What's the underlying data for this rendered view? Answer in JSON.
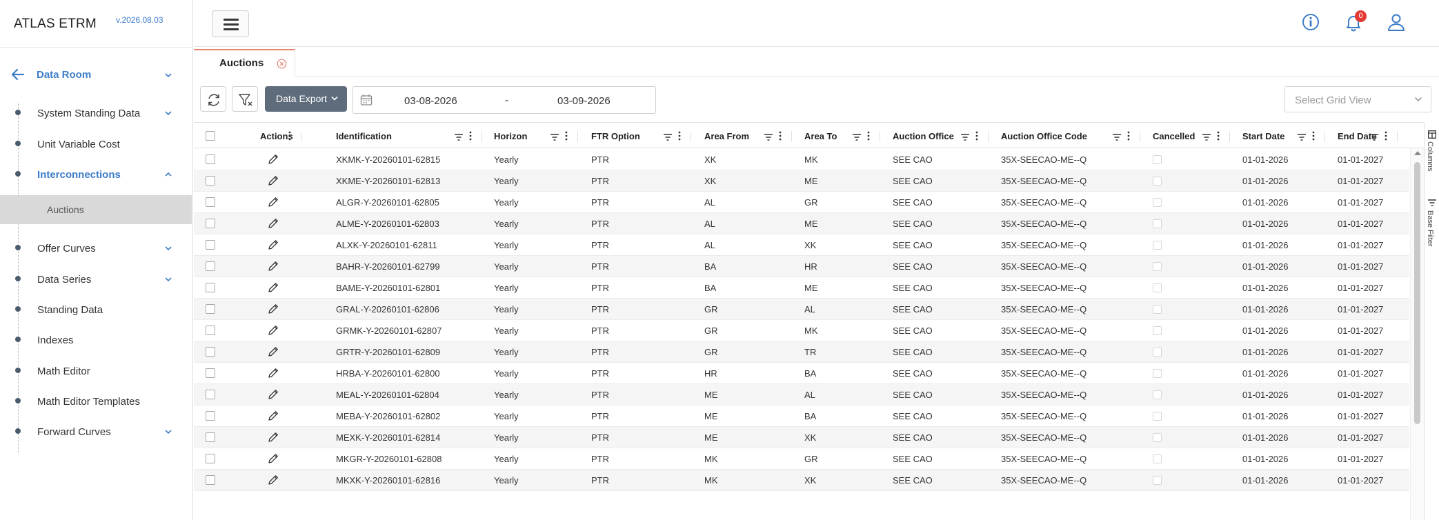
{
  "app": {
    "title": "ATLAS ETRM",
    "version": "v.2026.08.03"
  },
  "sidebar": {
    "top": {
      "label": "Data Room"
    },
    "items": [
      {
        "label": "System Standing Data",
        "expandable": true
      },
      {
        "label": "Unit Variable Cost",
        "expandable": false
      },
      {
        "label": "Interconnections",
        "expandable": true,
        "active": true
      },
      {
        "label": "Offer Curves",
        "expandable": true
      },
      {
        "label": "Data Series",
        "expandable": true
      },
      {
        "label": "Standing Data",
        "expandable": false
      },
      {
        "label": "Indexes",
        "expandable": false
      },
      {
        "label": "Math Editor",
        "expandable": false
      },
      {
        "label": "Math Editor Templates",
        "expandable": false
      },
      {
        "label": "Forward Curves",
        "expandable": true
      }
    ],
    "sub_item": {
      "label": "Auctions"
    }
  },
  "topbar": {
    "notification_count": "0",
    "icons": [
      "menu-icon",
      "info-icon",
      "bell-icon",
      "user-icon"
    ]
  },
  "tabs": [
    {
      "label": "Auctions",
      "active": true
    }
  ],
  "toolbar": {
    "export_label": "Data Export",
    "date_from": "03-08-2026",
    "date_separator": "-",
    "date_to": "03-09-2026",
    "grid_view_placeholder": "Select Grid View"
  },
  "grid": {
    "columns": [
      "Actions",
      "Identification",
      "Horizon",
      "FTR Option",
      "Area From",
      "Area To",
      "Auction Office",
      "Auction Office Code",
      "Cancelled",
      "Start Date",
      "End Date"
    ],
    "rows": [
      {
        "id": "XKMK-Y-20260101-62815",
        "horizon": "Yearly",
        "ftr": "PTR",
        "from": "XK",
        "to": "MK",
        "office": "SEE CAO",
        "code": "35X-SEECAO-ME--Q",
        "start": "01-01-2026",
        "end": "01-01-2027"
      },
      {
        "id": "XKME-Y-20260101-62813",
        "horizon": "Yearly",
        "ftr": "PTR",
        "from": "XK",
        "to": "ME",
        "office": "SEE CAO",
        "code": "35X-SEECAO-ME--Q",
        "start": "01-01-2026",
        "end": "01-01-2027"
      },
      {
        "id": "ALGR-Y-20260101-62805",
        "horizon": "Yearly",
        "ftr": "PTR",
        "from": "AL",
        "to": "GR",
        "office": "SEE CAO",
        "code": "35X-SEECAO-ME--Q",
        "start": "01-01-2026",
        "end": "01-01-2027"
      },
      {
        "id": "ALME-Y-20260101-62803",
        "horizon": "Yearly",
        "ftr": "PTR",
        "from": "AL",
        "to": "ME",
        "office": "SEE CAO",
        "code": "35X-SEECAO-ME--Q",
        "start": "01-01-2026",
        "end": "01-01-2027"
      },
      {
        "id": "ALXK-Y-20260101-62811",
        "horizon": "Yearly",
        "ftr": "PTR",
        "from": "AL",
        "to": "XK",
        "office": "SEE CAO",
        "code": "35X-SEECAO-ME--Q",
        "start": "01-01-2026",
        "end": "01-01-2027"
      },
      {
        "id": "BAHR-Y-20260101-62799",
        "horizon": "Yearly",
        "ftr": "PTR",
        "from": "BA",
        "to": "HR",
        "office": "SEE CAO",
        "code": "35X-SEECAO-ME--Q",
        "start": "01-01-2026",
        "end": "01-01-2027"
      },
      {
        "id": "BAME-Y-20260101-62801",
        "horizon": "Yearly",
        "ftr": "PTR",
        "from": "BA",
        "to": "ME",
        "office": "SEE CAO",
        "code": "35X-SEECAO-ME--Q",
        "start": "01-01-2026",
        "end": "01-01-2027"
      },
      {
        "id": "GRAL-Y-20260101-62806",
        "horizon": "Yearly",
        "ftr": "PTR",
        "from": "GR",
        "to": "AL",
        "office": "SEE CAO",
        "code": "35X-SEECAO-ME--Q",
        "start": "01-01-2026",
        "end": "01-01-2027"
      },
      {
        "id": "GRMK-Y-20260101-62807",
        "horizon": "Yearly",
        "ftr": "PTR",
        "from": "GR",
        "to": "MK",
        "office": "SEE CAO",
        "code": "35X-SEECAO-ME--Q",
        "start": "01-01-2026",
        "end": "01-01-2027"
      },
      {
        "id": "GRTR-Y-20260101-62809",
        "horizon": "Yearly",
        "ftr": "PTR",
        "from": "GR",
        "to": "TR",
        "office": "SEE CAO",
        "code": "35X-SEECAO-ME--Q",
        "start": "01-01-2026",
        "end": "01-01-2027"
      },
      {
        "id": "HRBA-Y-20260101-62800",
        "horizon": "Yearly",
        "ftr": "PTR",
        "from": "HR",
        "to": "BA",
        "office": "SEE CAO",
        "code": "35X-SEECAO-ME--Q",
        "start": "01-01-2026",
        "end": "01-01-2027"
      },
      {
        "id": "MEAL-Y-20260101-62804",
        "horizon": "Yearly",
        "ftr": "PTR",
        "from": "ME",
        "to": "AL",
        "office": "SEE CAO",
        "code": "35X-SEECAO-ME--Q",
        "start": "01-01-2026",
        "end": "01-01-2027"
      },
      {
        "id": "MEBA-Y-20260101-62802",
        "horizon": "Yearly",
        "ftr": "PTR",
        "from": "ME",
        "to": "BA",
        "office": "SEE CAO",
        "code": "35X-SEECAO-ME--Q",
        "start": "01-01-2026",
        "end": "01-01-2027"
      },
      {
        "id": "MEXK-Y-20260101-62814",
        "horizon": "Yearly",
        "ftr": "PTR",
        "from": "ME",
        "to": "XK",
        "office": "SEE CAO",
        "code": "35X-SEECAO-ME--Q",
        "start": "01-01-2026",
        "end": "01-01-2027"
      },
      {
        "id": "MKGR-Y-20260101-62808",
        "horizon": "Yearly",
        "ftr": "PTR",
        "from": "MK",
        "to": "GR",
        "office": "SEE CAO",
        "code": "35X-SEECAO-ME--Q",
        "start": "01-01-2026",
        "end": "01-01-2027"
      },
      {
        "id": "MKXK-Y-20260101-62816",
        "horizon": "Yearly",
        "ftr": "PTR",
        "from": "MK",
        "to": "XK",
        "office": "SEE CAO",
        "code": "35X-SEECAO-ME--Q",
        "start": "01-01-2026",
        "end": "01-01-2027"
      }
    ]
  },
  "side_panel": {
    "columns_label": "Columns",
    "filter_label": "Base Filter"
  },
  "colors": {
    "accent": "#3d7dc8",
    "badge": "#e53935",
    "export_button": "#5e6c7b",
    "tab_accent": "#e4846f"
  }
}
